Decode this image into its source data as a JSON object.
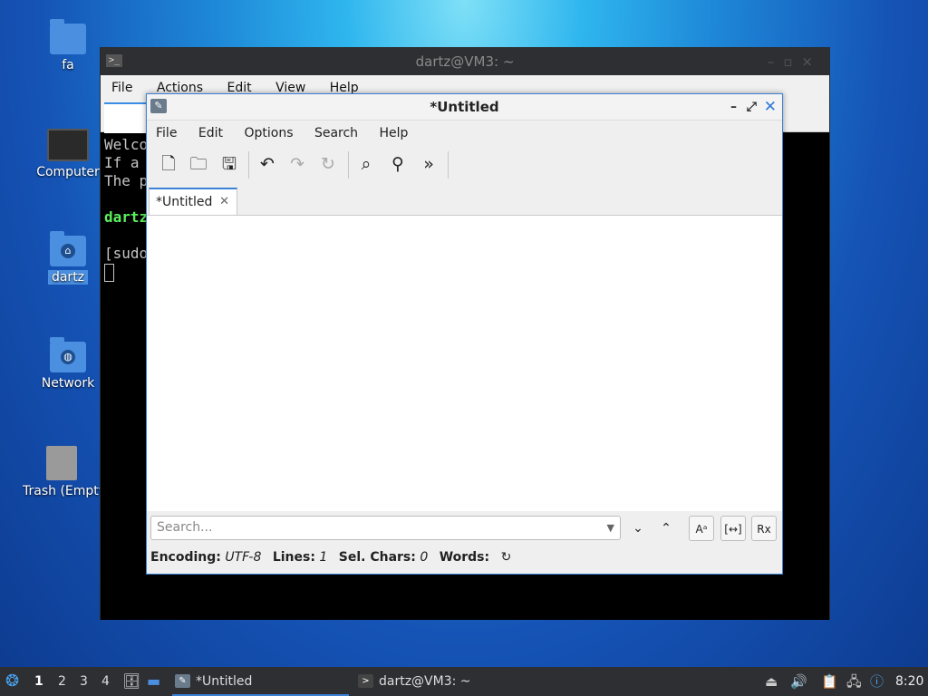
{
  "desktop": {
    "icons": [
      {
        "label": "fa"
      },
      {
        "label": "Computer"
      },
      {
        "label": "dartz"
      },
      {
        "label": "Network"
      },
      {
        "label": "Trash (Empty)"
      }
    ]
  },
  "terminal": {
    "title": "dartz@VM3: ~",
    "icon": ">_",
    "menu": [
      "File",
      "Actions",
      "Edit",
      "View",
      "Help"
    ],
    "lines": [
      "Welco",
      "If a",
      "The p",
      "",
      "dartz",
      "",
      "[sudo"
    ]
  },
  "featherpad": {
    "title": "*Untitled",
    "menu": [
      "File",
      "Edit",
      "Options",
      "Search",
      "Help"
    ],
    "tab_label": "*Untitled",
    "search_placeholder": "Search...",
    "status": {
      "encoding_label": "Encoding:",
      "encoding_value": "UTF-8",
      "lines_label": "Lines:",
      "lines_value": "1",
      "sel_label": "Sel. Chars:",
      "sel_value": "0",
      "words_label": "Words:"
    }
  },
  "taskbar": {
    "workspaces": [
      "1",
      "2",
      "3",
      "4"
    ],
    "active_workspace": "1",
    "tasks": [
      {
        "label": "*Untitled",
        "active": true
      },
      {
        "label": "dartz@VM3: ~",
        "active": false
      }
    ],
    "clock": "8:20"
  }
}
